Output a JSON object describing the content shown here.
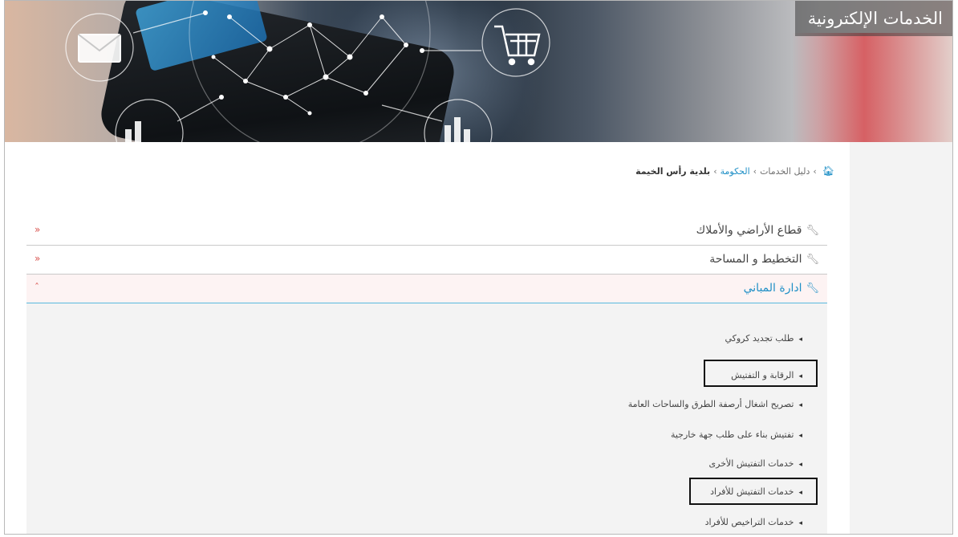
{
  "header": {
    "title": "الخدمات الإلكترونية"
  },
  "breadcrumb": {
    "home_icon": "home-icon",
    "items": [
      "دليل الخدمات",
      "الحكومة",
      "بلدية رأس الخيمة"
    ],
    "separator": "›"
  },
  "accordion": {
    "items": [
      {
        "label": "قطاع الأراضي والأملاك",
        "icon": "wrench-icon",
        "expanded": false,
        "toggle": "«"
      },
      {
        "label": "التخطيط و المساحة",
        "icon": "wrench-icon",
        "expanded": false,
        "toggle": "«"
      },
      {
        "label": "ادارة المباني",
        "icon": "wrench-icon",
        "expanded": true,
        "toggle": "ˆ"
      }
    ]
  },
  "services": {
    "bullet": "◂",
    "items": [
      "طلب تجديد كروكي",
      "الرقابة و التفتيش",
      "تصريح اشغال أرصفة الطرق والساحات العامة",
      "تفتيش بناء على طلب جهة خارجية",
      "خدمات التفتيش الأخرى",
      "خدمات التفتيش للأفراد",
      "خدمات التراخيص للأفراد"
    ],
    "highlighted": [
      "الرقابة و التفتيش",
      "خدمات التفتيش للأفراد"
    ]
  },
  "colors": {
    "accent_blue": "#1e8fc6",
    "toggle_red": "#d9534f",
    "open_underline": "#57b9de",
    "panel_bg": "#f3f3f3"
  }
}
